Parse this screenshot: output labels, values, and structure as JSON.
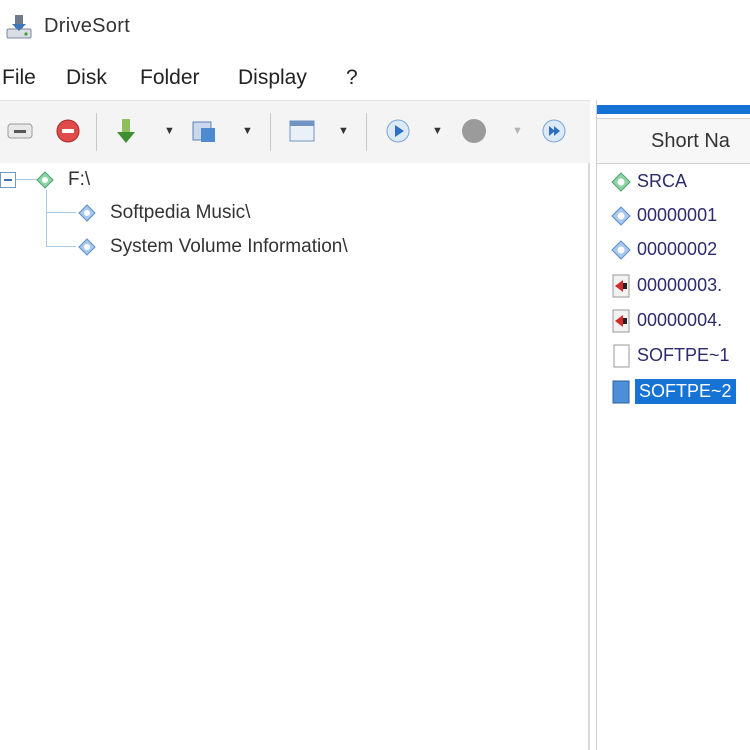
{
  "window": {
    "title": "DriveSort"
  },
  "menu": {
    "items": [
      "File",
      "Disk",
      "Folder",
      "Display",
      "?"
    ]
  },
  "toolbar": {
    "buttons": [
      "minus",
      "stop",
      "sort-down",
      "view",
      "layout",
      "play",
      "record",
      "forward"
    ]
  },
  "tree": {
    "root": {
      "label": "F:\\"
    },
    "children": [
      {
        "label": "Softpedia Music\\"
      },
      {
        "label": "System Volume Information\\"
      }
    ]
  },
  "files": {
    "header": "Short Na",
    "rows": [
      {
        "name": "SRCA",
        "icon": "folder-green"
      },
      {
        "name": "00000001",
        "icon": "folder-blue"
      },
      {
        "name": "00000002",
        "icon": "folder-blue"
      },
      {
        "name": "00000003.",
        "icon": "audio-file"
      },
      {
        "name": "00000004.",
        "icon": "audio-file"
      },
      {
        "name": "SOFTPE~1",
        "icon": "blank-file"
      },
      {
        "name": "SOFTPE~2",
        "icon": "blue-file",
        "selected": true
      }
    ]
  },
  "colors": {
    "accent": "#1673d6",
    "tree_line": "#a9c9e6"
  }
}
